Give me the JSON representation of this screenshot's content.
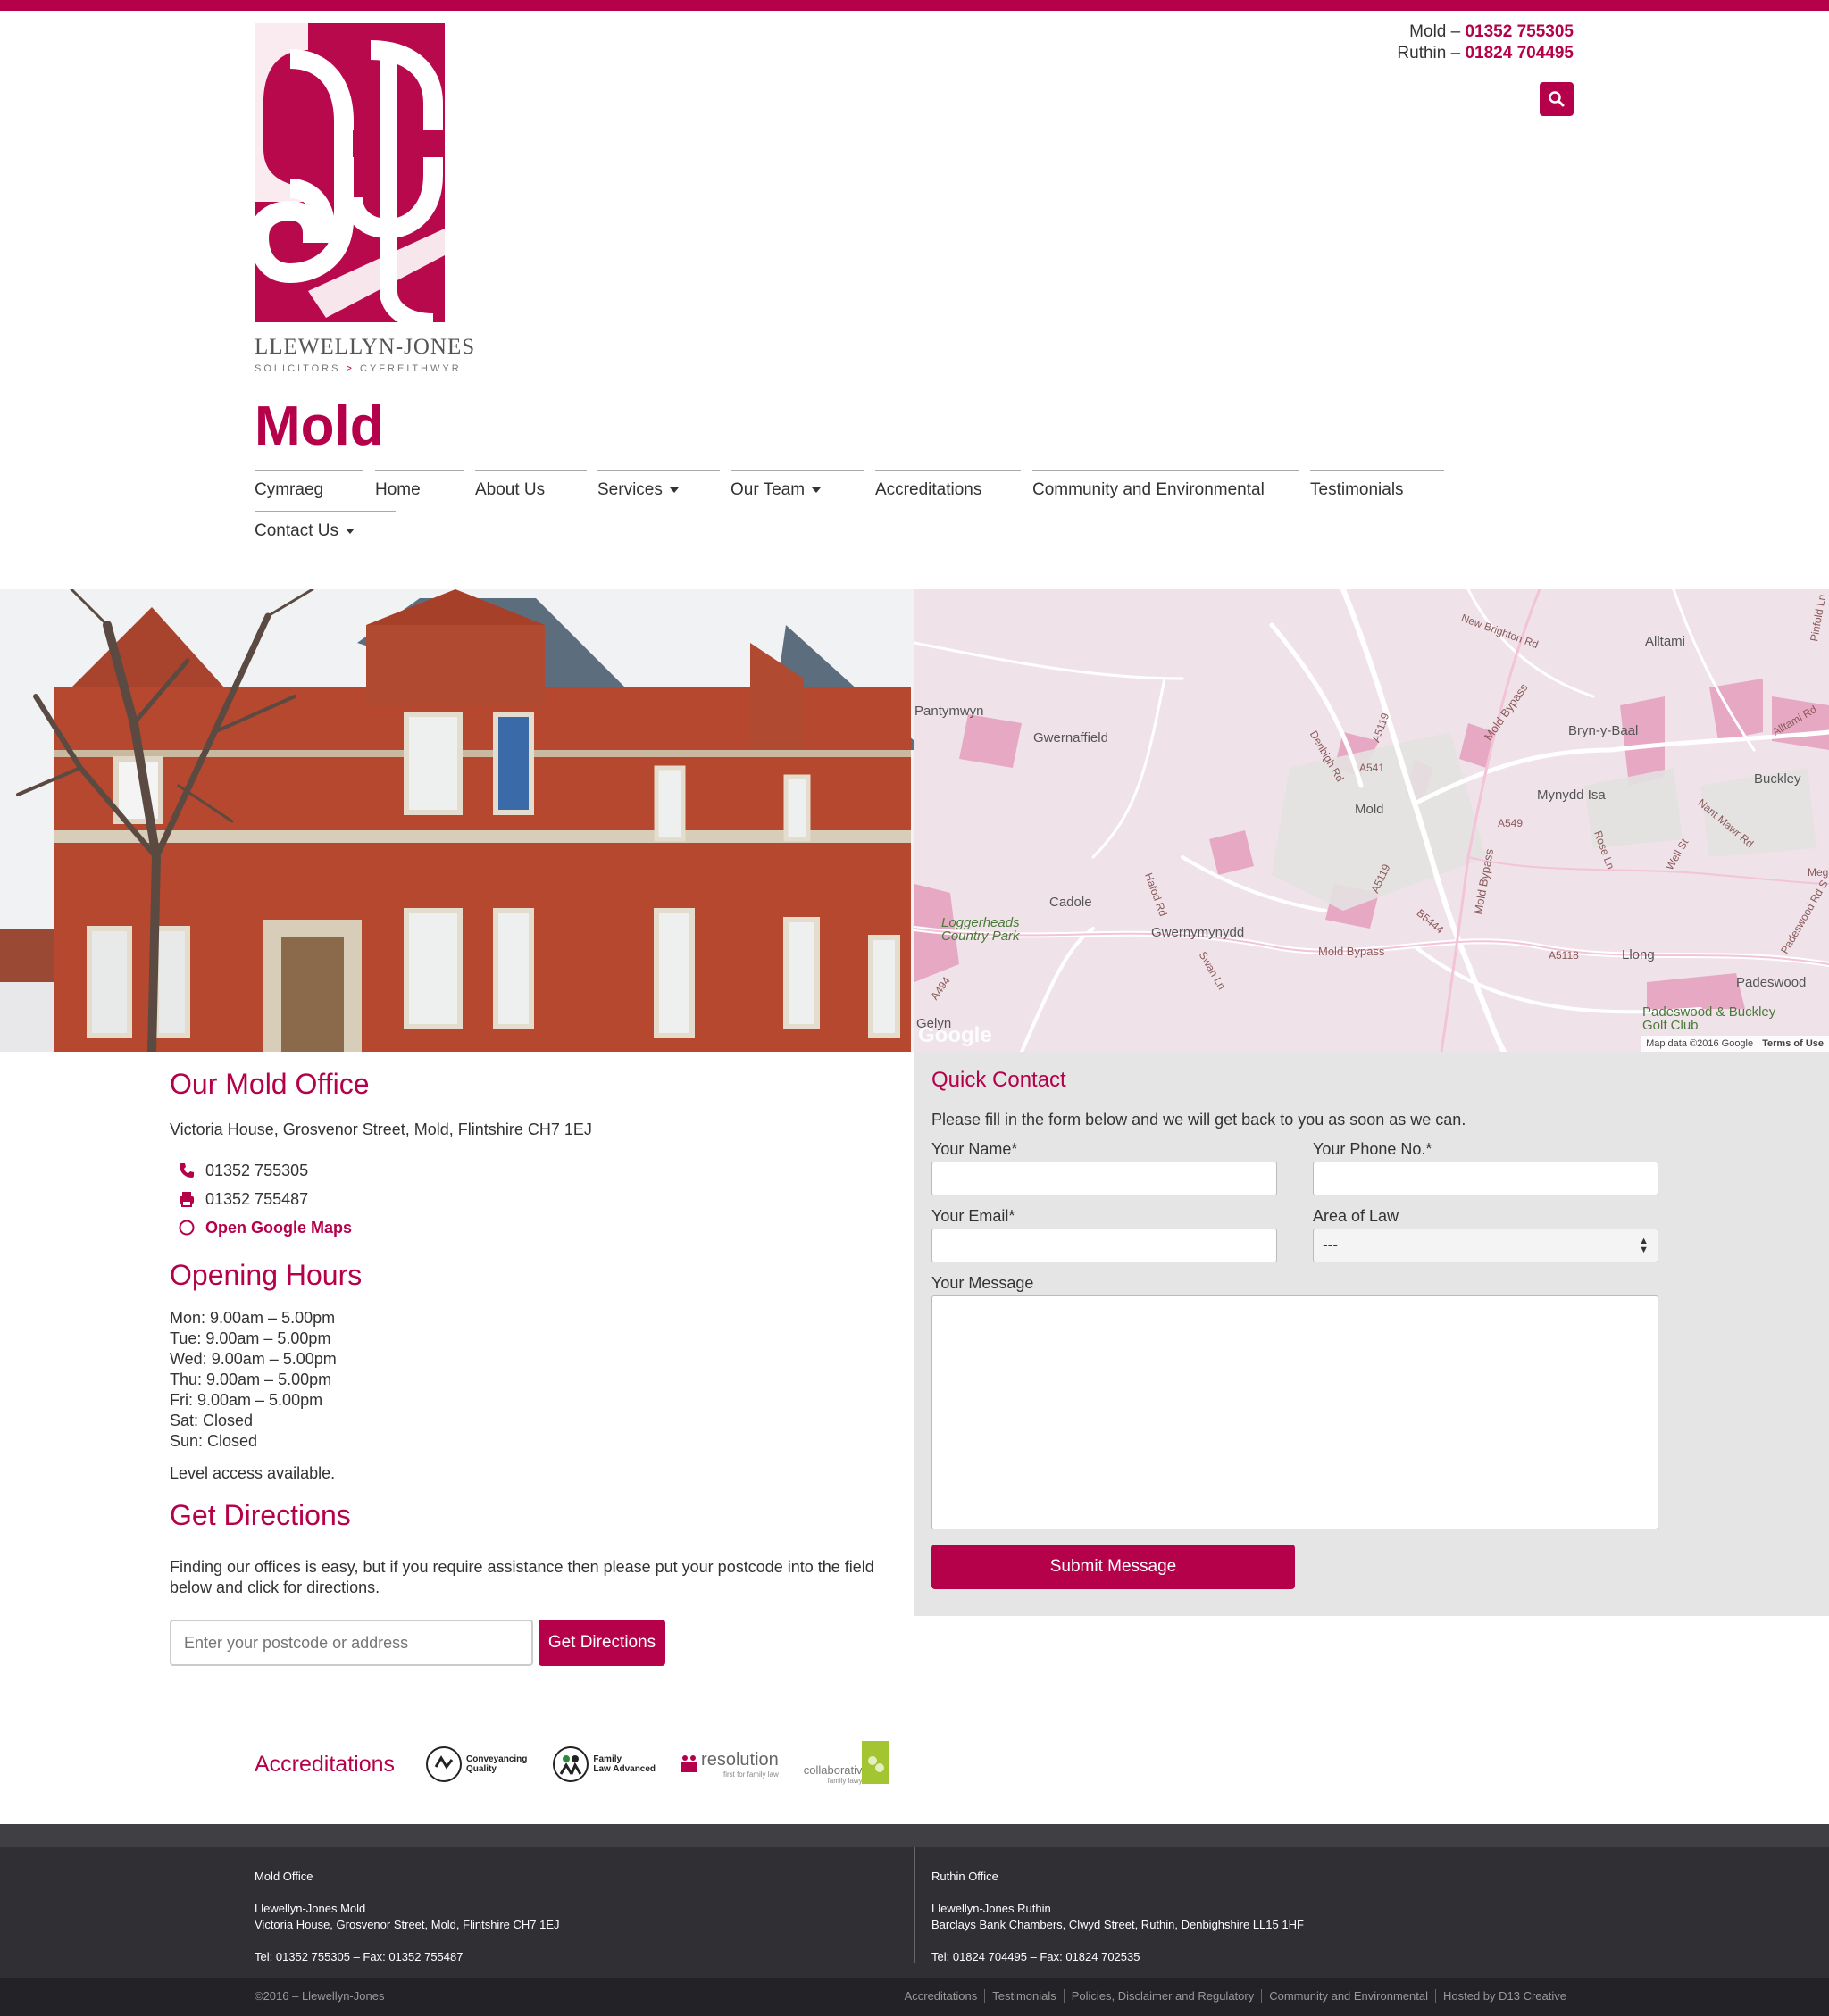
{
  "header": {
    "logo": {
      "name": "LLEWELLYN-JONES",
      "tagline_left": "SOLICITORS",
      "tagline_arrow": ">",
      "tagline_right": "CYFREITHWYR"
    },
    "phones": [
      {
        "label": "Mold –",
        "number": "01352 755305"
      },
      {
        "label": "Ruthin –",
        "number": "01824 704495"
      }
    ],
    "search_icon": "search-icon"
  },
  "page_title": "Mold",
  "nav": {
    "items": [
      {
        "label": "Cymraeg"
      },
      {
        "label": "Home"
      },
      {
        "label": "About Us"
      },
      {
        "label": "Services"
      },
      {
        "label": "Our Team"
      },
      {
        "label": "Accreditations"
      },
      {
        "label": "Community and Environmental"
      },
      {
        "label": "Testimonials"
      },
      {
        "label": "Contact Us"
      }
    ]
  },
  "map": {
    "places": [
      "Pantymwyn",
      "Gwernaffield",
      "Mold",
      "Bryn-y-Baal",
      "Mynydd Isa",
      "Buckley",
      "Alltami",
      "Cadole",
      "Gwernymynydd",
      "Loggerheads Country Park",
      "Llong",
      "Padeswood",
      "Padeswood & Buckley Golf Club",
      "Gelyn"
    ],
    "roads": [
      "A541",
      "A5119",
      "A549",
      "B5444",
      "A5118",
      "A494",
      "Mold Bypass",
      "Mold Bypass",
      "Mold Bypass",
      "A5119",
      "New Brighton Rd",
      "Alltami Rd",
      "Denbigh Rd",
      "Hafod Rd",
      "Swan Ln",
      "Nant Mawr Rd",
      "Padeswood Rd S",
      "Rose Ln",
      "Well St",
      "Pinfold Ln",
      "Meg"
    ],
    "google": "Google",
    "attribution": "Map data ©2016 Google",
    "terms": "Terms of Use"
  },
  "office": {
    "title": "Our Mold Office",
    "address": "Victoria House, Grosvenor Street, Mold, Flintshire CH7 1EJ",
    "phone": "01352 755305",
    "fax": "01352 755487",
    "maps_link": "Open Google Maps"
  },
  "hours": {
    "title": "Opening Hours",
    "lines": [
      "Mon: 9.00am – 5.00pm",
      "Tue: 9.00am – 5.00pm",
      "Wed: 9.00am – 5.00pm",
      "Thu: 9.00am – 5.00pm",
      "Fri: 9.00am – 5.00pm",
      "Sat: Closed",
      "Sun: Closed"
    ],
    "access": "Level access available."
  },
  "directions": {
    "title": "Get Directions",
    "text": "Finding our offices is easy, but if you require assistance then please put your postcode into the field below and click for directions.",
    "placeholder": "Enter your postcode or address",
    "button": "Get Directions"
  },
  "quick_contact": {
    "title": "Quick Contact",
    "intro": "Please fill in the form below and we will get back to you as soon as we can.",
    "name_label": "Your Name*",
    "phone_label": "Your Phone No.*",
    "email_label": "Your Email*",
    "area_label": "Area of Law",
    "area_value": "---",
    "message_label": "Your Message",
    "submit": "Submit Message"
  },
  "accreditations": {
    "title": "Accreditations",
    "badges": [
      {
        "line1": "Conveyancing",
        "line2": "Quality"
      },
      {
        "line1": "Family",
        "line2": "Law Advanced"
      },
      {
        "line1": "resolution",
        "line2": "first for family law"
      },
      {
        "line1": "collaborative",
        "line2": "family lawyer"
      }
    ]
  },
  "footer": {
    "mold": {
      "heading": "Mold Office",
      "name": "Llewellyn-Jones Mold",
      "address": "Victoria House, Grosvenor Street, Mold, Flintshire CH7 1EJ",
      "tel": "Tel: 01352 755305 – Fax: 01352 755487"
    },
    "ruthin": {
      "heading": "Ruthin Office",
      "name": "Llewellyn-Jones Ruthin",
      "address": "Barclays Bank Chambers, Clwyd Street, Ruthin, Denbighshire LL15 1HF",
      "tel": "Tel: 01824 704495 – Fax: 01824 702535"
    },
    "copyright": "©2016 – Llewellyn-Jones",
    "links": [
      "Accreditations",
      "Testimonials",
      "Policies, Disclaimer and Regulatory",
      "Community and Environmental",
      "Hosted by D13 Creative"
    ]
  },
  "colors": {
    "brand": "#b5004a",
    "footer": "#2f2f34",
    "form_bg": "#e5e5e5"
  }
}
